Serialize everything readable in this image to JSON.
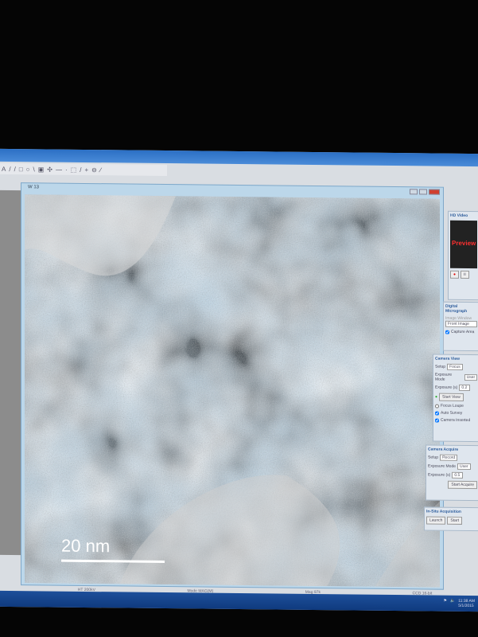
{
  "toolbar": {
    "icons": [
      "A",
      "/",
      "/",
      "□",
      "○",
      "\\",
      "▣",
      "✣",
      "—",
      "·",
      "⬚",
      "/",
      "+",
      "⊖",
      "⁄"
    ]
  },
  "image_window": {
    "title": "W 13",
    "scale_bar_label": "20 nm"
  },
  "hd_video": {
    "title": "HD Video",
    "overlay": "Preview"
  },
  "digital_micrograph": {
    "title": "Digital Micrograph",
    "image_window": "Image Window",
    "front_image": "Front Image",
    "capture": "Capture Area"
  },
  "camera_view": {
    "title": "Camera View",
    "setup_label": "Setup",
    "setup_value": "Focus",
    "exposure_mode_label": "Exposure Mode",
    "exposure_mode_value": "User",
    "exposure_label": "Exposure (s)",
    "exposure_value": "0.2",
    "start_button": "Start View",
    "focus_loupe": "Focus Loupe",
    "auto_survey": "Auto Survey",
    "camera_inserted": "Camera Inserted"
  },
  "camera_acquire": {
    "title": "Camera Acquire",
    "setup_label": "Setup",
    "setup_value": "Record",
    "exposure_mode_label": "Exposure Mode",
    "exposure_mode_value": "User",
    "exposure_label": "Exposure (s)",
    "exposure_value": "0.5",
    "start_button": "Start Acquire"
  },
  "in_situ": {
    "title": "In-Situ Acquisition",
    "launch": "Launch",
    "start": "Start"
  },
  "status": {
    "s1": "HT 200kV",
    "s2": "Mode MAG(M)",
    "s3": "Mag 97k",
    "s4": "CCD 16-bit"
  },
  "tray": {
    "time": "11:38 AM",
    "date": "5/1/2015"
  }
}
